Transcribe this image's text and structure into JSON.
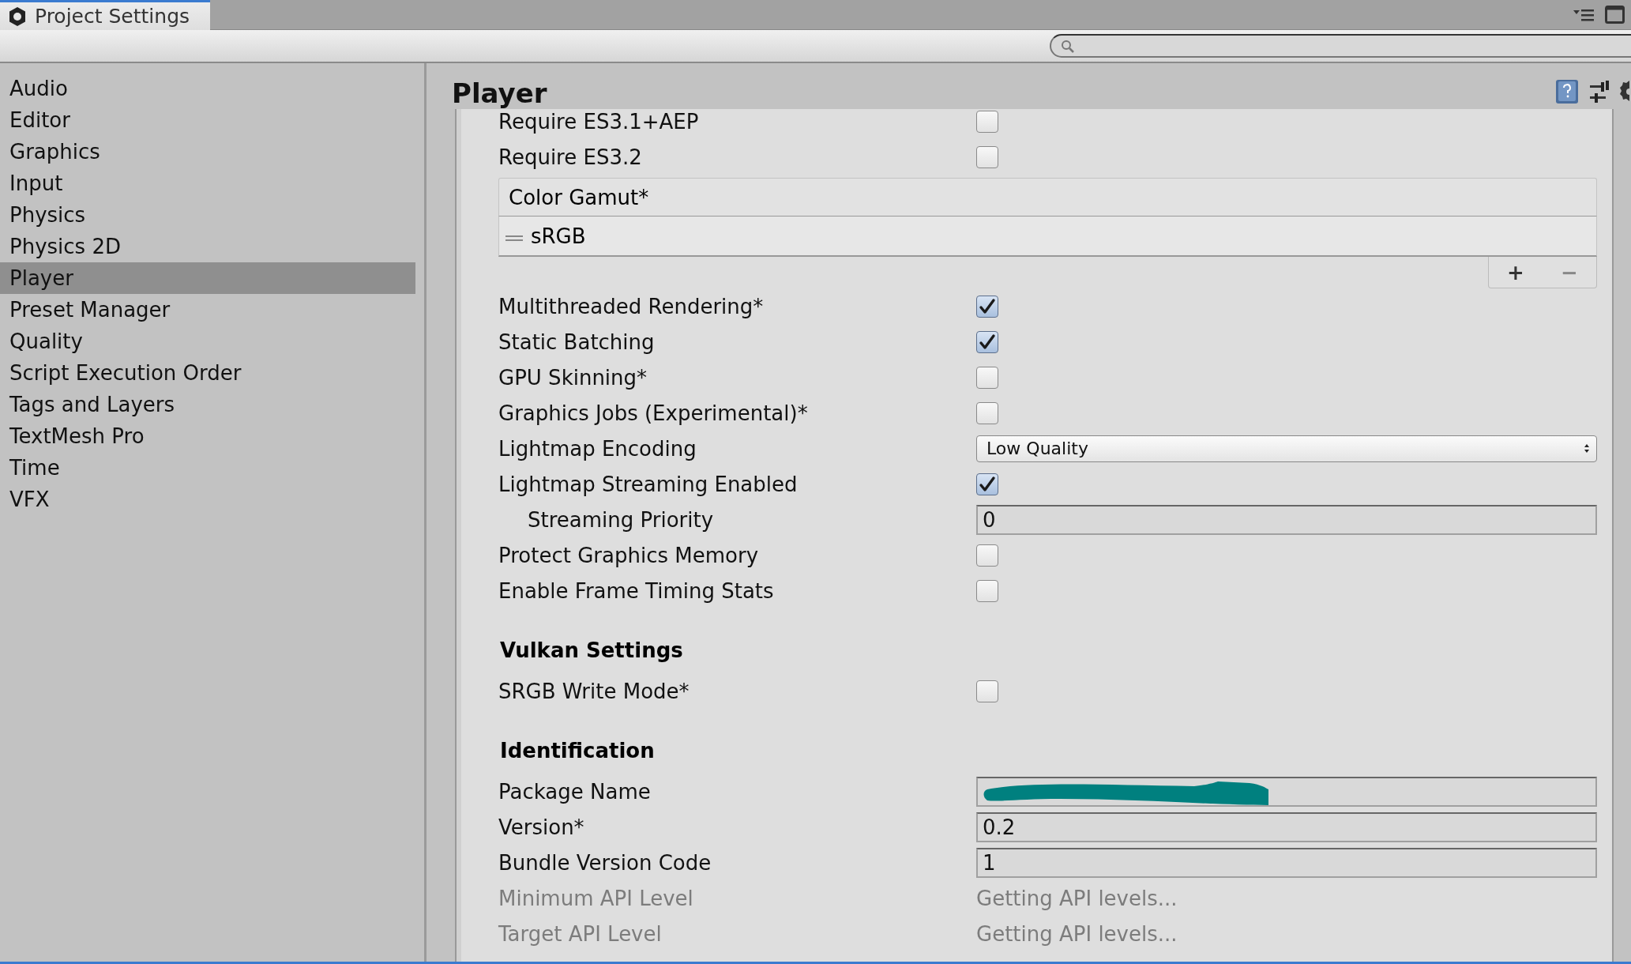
{
  "window": {
    "tab_title": "Project Settings"
  },
  "sidebar": {
    "items": [
      {
        "label": "Audio",
        "selected": false
      },
      {
        "label": "Editor",
        "selected": false
      },
      {
        "label": "Graphics",
        "selected": false
      },
      {
        "label": "Input",
        "selected": false
      },
      {
        "label": "Physics",
        "selected": false
      },
      {
        "label": "Physics 2D",
        "selected": false
      },
      {
        "label": "Player",
        "selected": true
      },
      {
        "label": "Preset Manager",
        "selected": false
      },
      {
        "label": "Quality",
        "selected": false
      },
      {
        "label": "Script Execution Order",
        "selected": false
      },
      {
        "label": "Tags and Layers",
        "selected": false
      },
      {
        "label": "TextMesh Pro",
        "selected": false
      },
      {
        "label": "Time",
        "selected": false
      },
      {
        "label": "VFX",
        "selected": false
      }
    ]
  },
  "panel": {
    "title": "Player"
  },
  "settings": [
    {
      "kind": "checkbox",
      "label": "Require ES3.1+AEP",
      "checked": false
    },
    {
      "kind": "checkbox",
      "label": "Require ES3.2",
      "checked": false
    },
    {
      "kind": "list",
      "title": "Color Gamut*",
      "items": [
        "sRGB"
      ],
      "add": "+",
      "remove": "−"
    },
    {
      "kind": "checkbox",
      "label": "Multithreaded Rendering*",
      "checked": true
    },
    {
      "kind": "checkbox",
      "label": "Static Batching",
      "checked": true
    },
    {
      "kind": "checkbox",
      "label": "GPU Skinning*",
      "checked": false
    },
    {
      "kind": "checkbox",
      "label": "Graphics Jobs (Experimental)*",
      "checked": false
    },
    {
      "kind": "dropdown",
      "label": "Lightmap Encoding",
      "value": "Low Quality"
    },
    {
      "kind": "checkbox",
      "label": "Lightmap Streaming Enabled",
      "checked": true,
      "children": [
        {
          "kind": "text",
          "label": "Streaming Priority",
          "value": "0"
        }
      ]
    },
    {
      "kind": "checkbox",
      "label": "Protect Graphics Memory",
      "checked": false
    },
    {
      "kind": "checkbox",
      "label": "Enable Frame Timing Stats",
      "checked": false
    },
    {
      "kind": "header",
      "label": "Vulkan Settings"
    },
    {
      "kind": "checkbox",
      "label": "SRGB Write Mode*",
      "checked": false
    },
    {
      "kind": "header",
      "label": "Identification"
    },
    {
      "kind": "text",
      "label": "Package Name",
      "redacted": true
    },
    {
      "kind": "text",
      "label": "Version*",
      "value": "0.2"
    },
    {
      "kind": "text",
      "label": "Bundle Version Code",
      "value": "1"
    },
    {
      "kind": "info",
      "label": "Minimum API Level",
      "value": "Getting API levels...",
      "disabled": true
    },
    {
      "kind": "info",
      "label": "Target API Level",
      "value": "Getting API levels...",
      "disabled": true
    }
  ]
}
